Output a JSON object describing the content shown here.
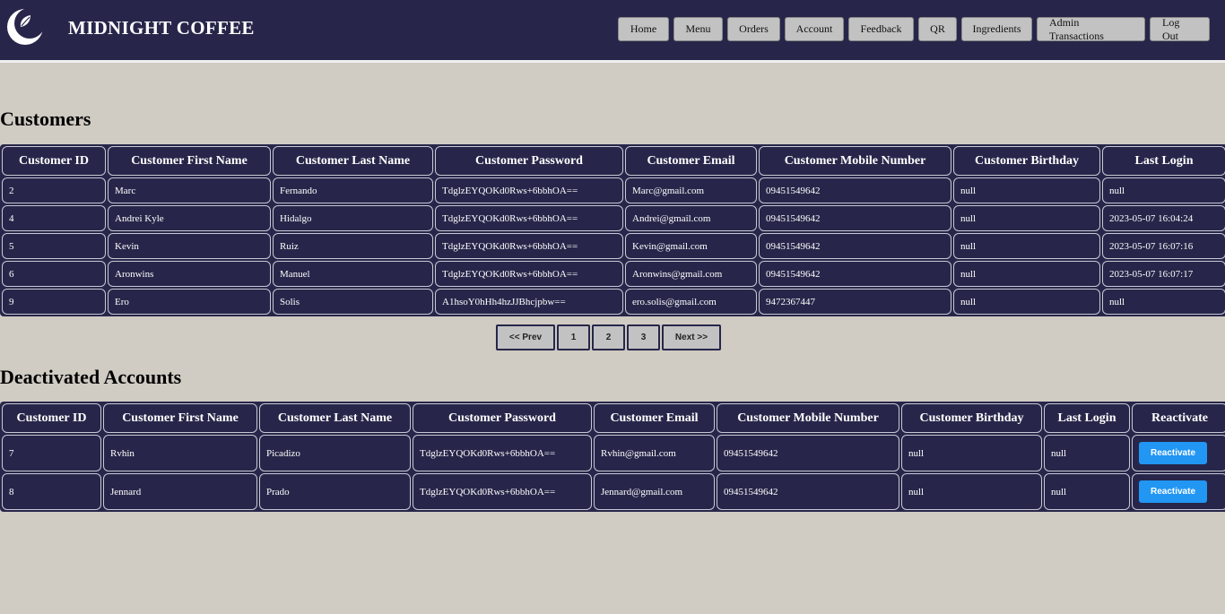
{
  "brand": {
    "name": "MIDNIGHT COFFEE"
  },
  "nav": [
    "Home",
    "Menu",
    "Orders",
    "Account",
    "Feedback",
    "QR",
    "Ingredients",
    "Admin Transactions",
    "Log Out"
  ],
  "customers": {
    "heading": "Customers",
    "columns": [
      "Customer ID",
      "Customer First Name",
      "Customer Last Name",
      "Customer Password",
      "Customer Email",
      "Customer Mobile Number",
      "Customer Birthday",
      "Last Login"
    ],
    "rows": [
      [
        "2",
        "Marc",
        "Fernando",
        "TdglzEYQOKd0Rws+6bbhOA==",
        "Marc@gmail.com",
        "09451549642",
        "null",
        "null"
      ],
      [
        "4",
        "Andrei Kyle",
        "Hidalgo",
        "TdglzEYQOKd0Rws+6bbhOA==",
        "Andrei@gmail.com",
        "09451549642",
        "null",
        "2023-05-07 16:04:24"
      ],
      [
        "5",
        "Kevin",
        "Ruiz",
        "TdglzEYQOKd0Rws+6bbhOA==",
        "Kevin@gmail.com",
        "09451549642",
        "null",
        "2023-05-07 16:07:16"
      ],
      [
        "6",
        "Aronwins",
        "Manuel",
        "TdglzEYQOKd0Rws+6bbhOA==",
        "Aronwins@gmail.com",
        "09451549642",
        "null",
        "2023-05-07 16:07:17"
      ],
      [
        "9",
        "Ero",
        "Solis",
        "A1hsoY0hHh4hzJJBhcjpbw==",
        "ero.solis@gmail.com",
        "9472367447",
        "null",
        "null"
      ]
    ]
  },
  "pagination": [
    "<< Prev",
    "1",
    "2",
    "3",
    "Next >>"
  ],
  "deactivated": {
    "heading": "Deactivated Accounts",
    "columns": [
      "Customer ID",
      "Customer First Name",
      "Customer Last Name",
      "Customer Password",
      "Customer Email",
      "Customer Mobile Number",
      "Customer Birthday",
      "Last Login",
      "Reactivate"
    ],
    "rows": [
      [
        "7",
        "Rvhin",
        "Picadizo",
        "TdglzEYQOKd0Rws+6bbhOA==",
        "Rvhin@gmail.com",
        "09451549642",
        "null",
        "null"
      ],
      [
        "8",
        "Jennard",
        "Prado",
        "TdglzEYQOKd0Rws+6bbhOA==",
        "Jennard@gmail.com",
        "09451549642",
        "null",
        "null"
      ]
    ],
    "action_label": "Reactivate"
  },
  "colors": {
    "header_bg": "#27264a",
    "page_bg": "#d0cbc3",
    "action_button": "#2196f3"
  }
}
